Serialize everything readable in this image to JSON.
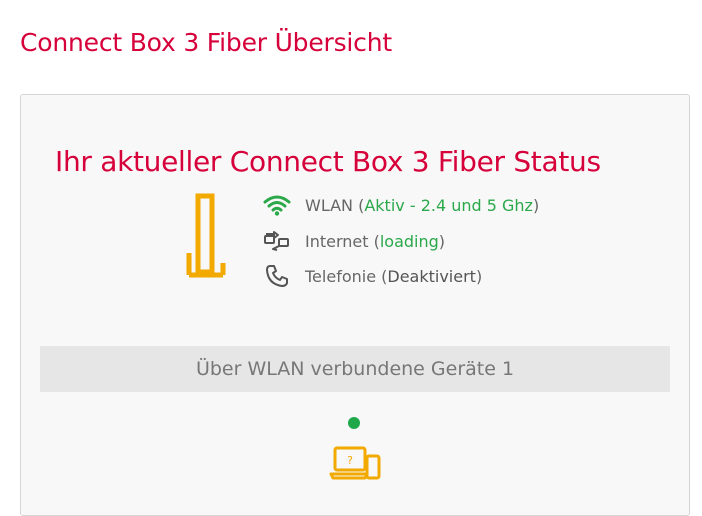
{
  "header": {
    "title": "Connect Box 3 Fiber Übersicht"
  },
  "status": {
    "heading": "Ihr aktueller Connect Box 3 Fiber Status",
    "wlan": {
      "label": "WLAN",
      "value": "Aktiv - 2.4 und 5 Ghz",
      "icon": "wifi-icon"
    },
    "internet": {
      "label": "Internet",
      "value": "loading",
      "icon": "internet-icon"
    },
    "telefonie": {
      "label": "Telefonie",
      "value": "Deaktiviert",
      "icon": "phone-icon"
    }
  },
  "devices": {
    "label": "Über WLAN verbundene Geräte 1",
    "status_color": "#1fa84a",
    "icon": "devices-icon"
  },
  "colors": {
    "brand": "#d6003a",
    "accent": "#f2a900",
    "active": "#2aa84a"
  }
}
